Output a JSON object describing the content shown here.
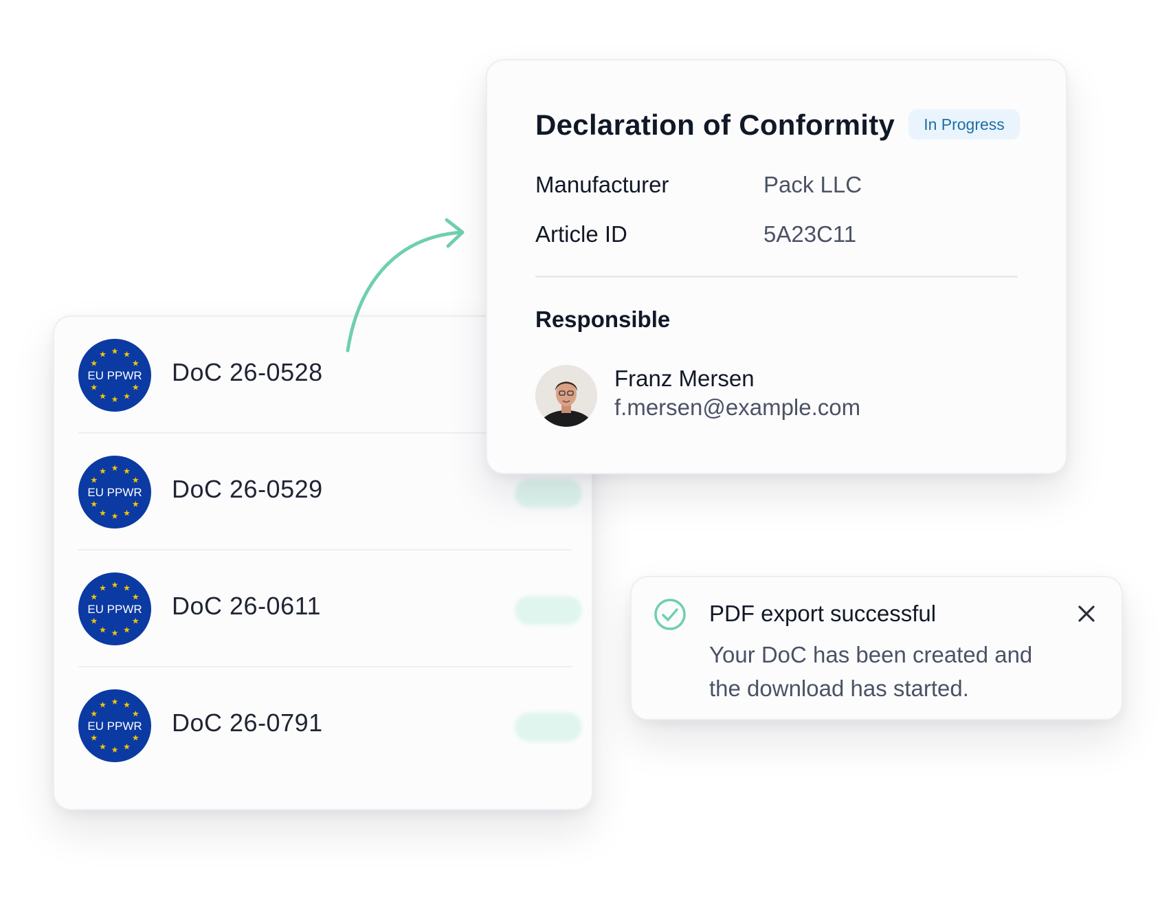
{
  "doc_list": {
    "badge_text": "EU PPWR",
    "items": [
      {
        "label": "DoC 26-0528"
      },
      {
        "label": "DoC 26-0529"
      },
      {
        "label": "DoC 26-0611"
      },
      {
        "label": "DoC 26-0791"
      }
    ]
  },
  "declaration": {
    "title": "Declaration of Conformity",
    "status": "In Progress",
    "fields": [
      {
        "label": "Manufacturer",
        "value": "Pack LLC"
      },
      {
        "label": "Article ID",
        "value": "5A23C11"
      }
    ],
    "responsible_heading": "Responsible",
    "person": {
      "name": "Franz Mersen",
      "email": "f.mersen@example.com"
    }
  },
  "toast": {
    "title": "PDF export successful",
    "message": "Your DoC has been created and the download has started.",
    "icon": "check-circle-icon",
    "close_icon": "close-icon"
  },
  "colors": {
    "badge_blue": "#0b3aa3",
    "badge_star": "#f7c600",
    "accent_green": "#6fcfb0",
    "status_tag_bg": "#eaf4fc",
    "status_tag_text": "#1c6ea4"
  }
}
